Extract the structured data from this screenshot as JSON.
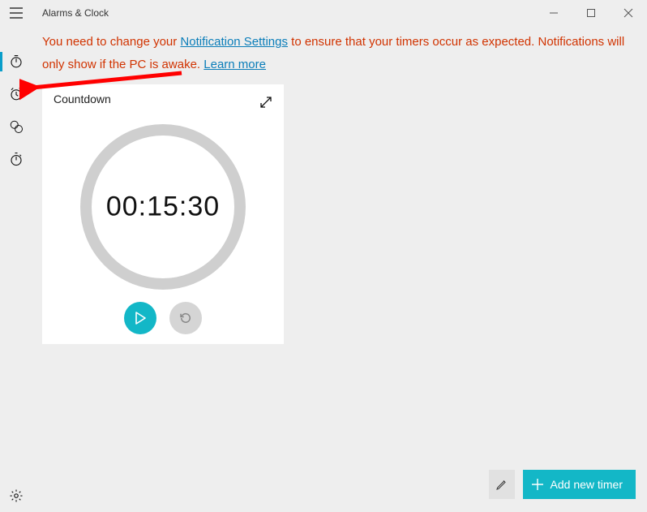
{
  "app_title": "Alarms & Clock",
  "warning": {
    "prefix": "You need to change your ",
    "link1": "Notification Settings",
    "mid": " to ensure that your timers occur as expected. Notifications will only show if the PC is awake. ",
    "link2": "Learn more"
  },
  "sidebar": {
    "items": [
      {
        "name": "timer",
        "active": true
      },
      {
        "name": "alarm",
        "active": false
      },
      {
        "name": "world-clock",
        "active": false
      },
      {
        "name": "stopwatch",
        "active": false
      }
    ]
  },
  "timer": {
    "name": "Countdown",
    "display": "00:15:30"
  },
  "buttons": {
    "add_timer": "Add new timer"
  }
}
